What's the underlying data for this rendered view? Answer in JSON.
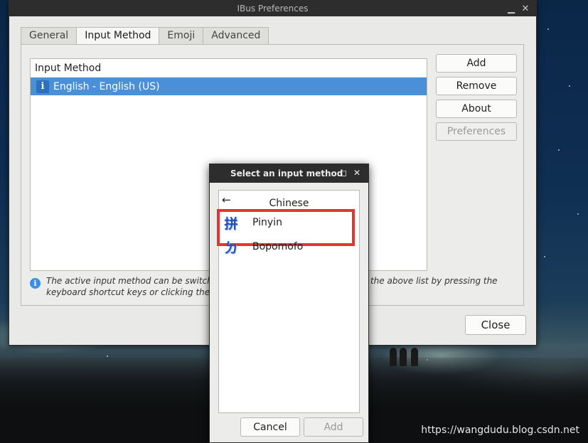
{
  "main_window": {
    "title": "IBus Preferences",
    "tabs": [
      {
        "label": "General",
        "active": false
      },
      {
        "label": "Input Method",
        "active": true
      },
      {
        "label": "Emoji",
        "active": false
      },
      {
        "label": "Advanced",
        "active": false
      }
    ],
    "list_header": "Input Method",
    "input_methods": [
      {
        "label": "English - English (US)",
        "icon": "info-icon",
        "selected": true
      }
    ],
    "buttons": {
      "add": "Add",
      "remove": "Remove",
      "about": "About",
      "preferences": "Preferences"
    },
    "hint_text": "The active input method can be switched around from the selected ones in the above list by pressing the keyboard shortcut keys or clicking the panel icon.",
    "close": "Close"
  },
  "dialog": {
    "title": "Select an input method",
    "group": "Chinese",
    "items": [
      {
        "label": "Pinyin",
        "glyph": "拼",
        "highlighted": true
      },
      {
        "label": "Bopomofo",
        "glyph": "ㄉ",
        "highlighted": false
      }
    ],
    "cancel": "Cancel",
    "add": "Add"
  },
  "colors": {
    "selection": "#4a90d9",
    "highlight_box": "#e53434",
    "titlebar": "#2d2d2d"
  },
  "watermark": "https://wangdudu.blog.csdn.net"
}
